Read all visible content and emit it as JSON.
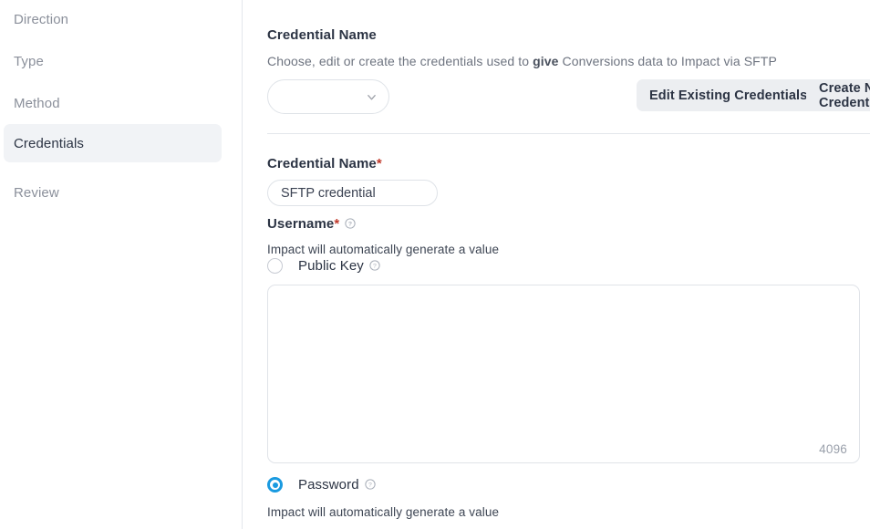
{
  "sidebar": {
    "items": [
      {
        "label": "Direction",
        "active": false
      },
      {
        "label": "Type",
        "active": false
      },
      {
        "label": "Method",
        "active": false
      },
      {
        "label": "Credentials",
        "active": true
      },
      {
        "label": "Review",
        "active": false
      }
    ]
  },
  "main": {
    "header": {
      "title": "Credential Name",
      "description_before": "Choose, edit or create the credentials used to ",
      "description_emphasis": "give",
      "description_after": " Conversions data to Impact via SFTP"
    },
    "credential_select": {
      "value": "",
      "placeholder": "",
      "icon": "chevron-down-icon"
    },
    "buttons": {
      "edit_existing": "Edit Existing Credentials",
      "create_new": "Create New Credentials"
    },
    "credential_name_field": {
      "label": "Credential Name",
      "required_marker": "*",
      "value": "SFTP credential",
      "placeholder": ""
    },
    "username_section": {
      "label": "Username",
      "required_marker": "*",
      "help_icon": "help-circle-icon",
      "helper_text": "Impact will automatically generate a value"
    },
    "public_key_option": {
      "label": "Public Key",
      "help_icon": "help-circle-icon",
      "selected": false
    },
    "public_key_textarea": {
      "value": "",
      "placeholder": "",
      "char_count": "4096"
    },
    "password_option": {
      "label": "Password",
      "help_icon": "help-circle-icon",
      "selected": true,
      "helper_text": "Impact will automatically generate a value"
    }
  },
  "colors": {
    "accent": "#1a9ae0",
    "required": "#c0392b",
    "text_dark": "#2c3444",
    "text_muted": "#8b909b",
    "button_bg": "#eceef1",
    "active_nav_bg": "#f1f3f6",
    "border": "#dfe3e8"
  }
}
